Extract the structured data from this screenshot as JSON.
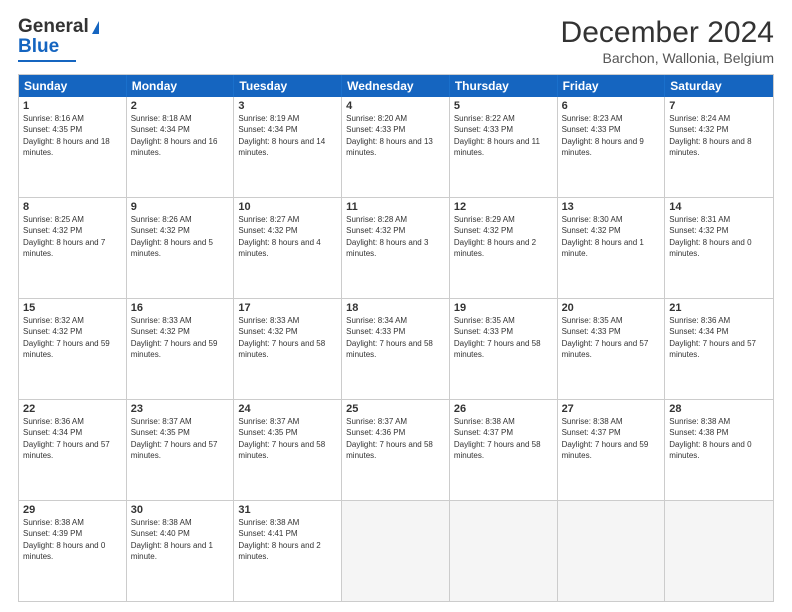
{
  "logo": {
    "line1": "General",
    "line2": "Blue"
  },
  "title": "December 2024",
  "subtitle": "Barchon, Wallonia, Belgium",
  "days": [
    "Sunday",
    "Monday",
    "Tuesday",
    "Wednesday",
    "Thursday",
    "Friday",
    "Saturday"
  ],
  "weeks": [
    [
      {
        "day": "1",
        "sunrise": "8:16 AM",
        "sunset": "4:35 PM",
        "daylight": "8 hours and 18 minutes."
      },
      {
        "day": "2",
        "sunrise": "8:18 AM",
        "sunset": "4:34 PM",
        "daylight": "8 hours and 16 minutes."
      },
      {
        "day": "3",
        "sunrise": "8:19 AM",
        "sunset": "4:34 PM",
        "daylight": "8 hours and 14 minutes."
      },
      {
        "day": "4",
        "sunrise": "8:20 AM",
        "sunset": "4:33 PM",
        "daylight": "8 hours and 13 minutes."
      },
      {
        "day": "5",
        "sunrise": "8:22 AM",
        "sunset": "4:33 PM",
        "daylight": "8 hours and 11 minutes."
      },
      {
        "day": "6",
        "sunrise": "8:23 AM",
        "sunset": "4:33 PM",
        "daylight": "8 hours and 9 minutes."
      },
      {
        "day": "7",
        "sunrise": "8:24 AM",
        "sunset": "4:32 PM",
        "daylight": "8 hours and 8 minutes."
      }
    ],
    [
      {
        "day": "8",
        "sunrise": "8:25 AM",
        "sunset": "4:32 PM",
        "daylight": "8 hours and 7 minutes."
      },
      {
        "day": "9",
        "sunrise": "8:26 AM",
        "sunset": "4:32 PM",
        "daylight": "8 hours and 5 minutes."
      },
      {
        "day": "10",
        "sunrise": "8:27 AM",
        "sunset": "4:32 PM",
        "daylight": "8 hours and 4 minutes."
      },
      {
        "day": "11",
        "sunrise": "8:28 AM",
        "sunset": "4:32 PM",
        "daylight": "8 hours and 3 minutes."
      },
      {
        "day": "12",
        "sunrise": "8:29 AM",
        "sunset": "4:32 PM",
        "daylight": "8 hours and 2 minutes."
      },
      {
        "day": "13",
        "sunrise": "8:30 AM",
        "sunset": "4:32 PM",
        "daylight": "8 hours and 1 minute."
      },
      {
        "day": "14",
        "sunrise": "8:31 AM",
        "sunset": "4:32 PM",
        "daylight": "8 hours and 0 minutes."
      }
    ],
    [
      {
        "day": "15",
        "sunrise": "8:32 AM",
        "sunset": "4:32 PM",
        "daylight": "7 hours and 59 minutes."
      },
      {
        "day": "16",
        "sunrise": "8:33 AM",
        "sunset": "4:32 PM",
        "daylight": "7 hours and 59 minutes."
      },
      {
        "day": "17",
        "sunrise": "8:33 AM",
        "sunset": "4:32 PM",
        "daylight": "7 hours and 58 minutes."
      },
      {
        "day": "18",
        "sunrise": "8:34 AM",
        "sunset": "4:33 PM",
        "daylight": "7 hours and 58 minutes."
      },
      {
        "day": "19",
        "sunrise": "8:35 AM",
        "sunset": "4:33 PM",
        "daylight": "7 hours and 58 minutes."
      },
      {
        "day": "20",
        "sunrise": "8:35 AM",
        "sunset": "4:33 PM",
        "daylight": "7 hours and 57 minutes."
      },
      {
        "day": "21",
        "sunrise": "8:36 AM",
        "sunset": "4:34 PM",
        "daylight": "7 hours and 57 minutes."
      }
    ],
    [
      {
        "day": "22",
        "sunrise": "8:36 AM",
        "sunset": "4:34 PM",
        "daylight": "7 hours and 57 minutes."
      },
      {
        "day": "23",
        "sunrise": "8:37 AM",
        "sunset": "4:35 PM",
        "daylight": "7 hours and 57 minutes."
      },
      {
        "day": "24",
        "sunrise": "8:37 AM",
        "sunset": "4:35 PM",
        "daylight": "7 hours and 58 minutes."
      },
      {
        "day": "25",
        "sunrise": "8:37 AM",
        "sunset": "4:36 PM",
        "daylight": "7 hours and 58 minutes."
      },
      {
        "day": "26",
        "sunrise": "8:38 AM",
        "sunset": "4:37 PM",
        "daylight": "7 hours and 58 minutes."
      },
      {
        "day": "27",
        "sunrise": "8:38 AM",
        "sunset": "4:37 PM",
        "daylight": "7 hours and 59 minutes."
      },
      {
        "day": "28",
        "sunrise": "8:38 AM",
        "sunset": "4:38 PM",
        "daylight": "8 hours and 0 minutes."
      }
    ],
    [
      {
        "day": "29",
        "sunrise": "8:38 AM",
        "sunset": "4:39 PM",
        "daylight": "8 hours and 0 minutes."
      },
      {
        "day": "30",
        "sunrise": "8:38 AM",
        "sunset": "4:40 PM",
        "daylight": "8 hours and 1 minute."
      },
      {
        "day": "31",
        "sunrise": "8:38 AM",
        "sunset": "4:41 PM",
        "daylight": "8 hours and 2 minutes."
      },
      null,
      null,
      null,
      null
    ]
  ]
}
